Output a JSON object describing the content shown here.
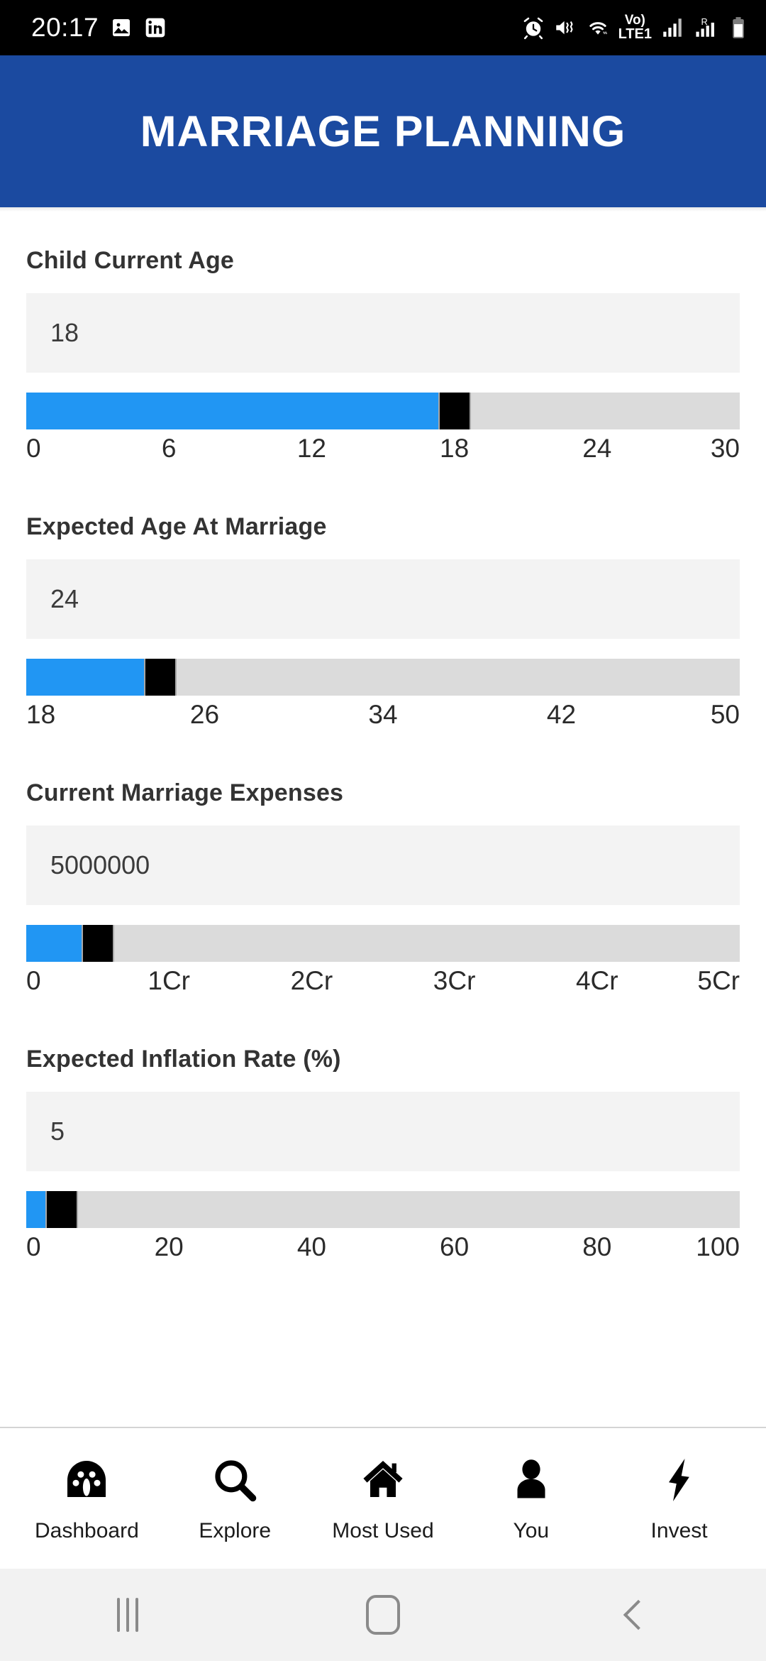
{
  "statusbar": {
    "time": "20:17",
    "left_icons": [
      "image-icon",
      "linkedin-icon"
    ],
    "right_icons": [
      "alarm-icon",
      "mute-vibrate-icon",
      "wifi-icon",
      "volte-icon",
      "signal-icon",
      "roaming-signal-icon",
      "battery-icon"
    ],
    "volte_top": "Vo)",
    "volte_bottom": "LTE1"
  },
  "appbar": {
    "title": "MARRIAGE PLANNING",
    "bg_color": "#1b4aa0"
  },
  "theme": {
    "accent": "#2196f3",
    "track": "#dbdbdb",
    "thumb": "#000000",
    "field_bg": "#f3f3f3"
  },
  "fields": [
    {
      "label": "Child Current Age",
      "value": "18",
      "min": 0,
      "max": 30,
      "current": 18,
      "ticks": [
        "0",
        "6",
        "12",
        "18",
        "24",
        "30"
      ],
      "tick_values": [
        0,
        6,
        12,
        18,
        24,
        30
      ]
    },
    {
      "label": "Expected Age At Marriage",
      "value": "24",
      "min": 18,
      "max": 50,
      "current": 24,
      "ticks": [
        "18",
        "26",
        "34",
        "42",
        "50"
      ],
      "tick_values": [
        18,
        26,
        34,
        42,
        50
      ]
    },
    {
      "label": "Current Marriage Expenses",
      "value": "5000000",
      "min": 0,
      "max": 50000000,
      "current": 5000000,
      "ticks": [
        "0",
        "1Cr",
        "2Cr",
        "3Cr",
        "4Cr",
        "5Cr"
      ],
      "tick_values": [
        0,
        10000000,
        20000000,
        30000000,
        40000000,
        50000000
      ]
    },
    {
      "label": "Expected Inflation Rate (%)",
      "value": "5",
      "min": 0,
      "max": 100,
      "current": 5,
      "ticks": [
        "0",
        "20",
        "40",
        "60",
        "80",
        "100"
      ],
      "tick_values": [
        0,
        20,
        40,
        60,
        80,
        100
      ]
    }
  ],
  "bottomnav": [
    {
      "label": "Dashboard",
      "icon": "dashboard-gauge-icon"
    },
    {
      "label": "Explore",
      "icon": "search-icon"
    },
    {
      "label": "Most Used",
      "icon": "home-icon"
    },
    {
      "label": "You",
      "icon": "person-icon"
    },
    {
      "label": "Invest",
      "icon": "lightning-bolt-icon"
    }
  ],
  "androidnav": [
    {
      "name": "recents-button"
    },
    {
      "name": "home-button"
    },
    {
      "name": "back-button"
    }
  ]
}
